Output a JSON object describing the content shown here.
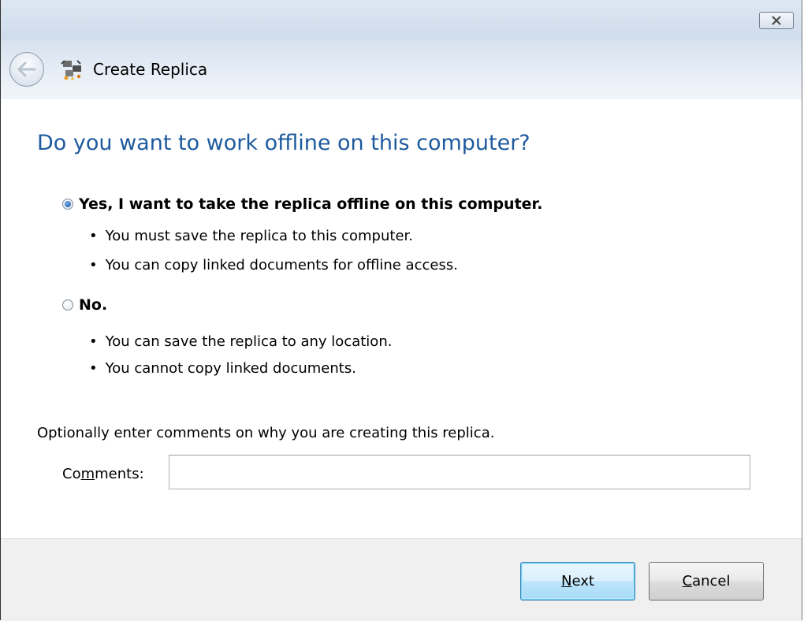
{
  "window": {
    "close_icon": "close-x-icon"
  },
  "header": {
    "back_icon": "back-arrow-icon",
    "app_icon": "replica-icon",
    "title": "Create Replica"
  },
  "main": {
    "question": "Do you want to work offline on this computer?",
    "options": [
      {
        "label": "Yes, I want to take the replica offline on this computer.",
        "selected": true,
        "bullets": [
          "You must save the replica to this computer.",
          "You can copy linked documents for offline access."
        ]
      },
      {
        "label": "No.",
        "selected": false,
        "bullets": [
          "You can save the replica to any location.",
          "You cannot copy linked documents."
        ]
      }
    ],
    "comments_intro": "Optionally enter comments on why you are creating this replica.",
    "comments_label_pre": "Co",
    "comments_label_accel": "m",
    "comments_label_post": "ments:",
    "comments_value": ""
  },
  "footer": {
    "next_accel": "N",
    "next_rest": "ext",
    "cancel_accel": "C",
    "cancel_rest": "ancel"
  },
  "colors": {
    "question_color": "#1e5a9e",
    "titlebar": "#cfdcec",
    "footer_bg": "#f0f0f0"
  }
}
